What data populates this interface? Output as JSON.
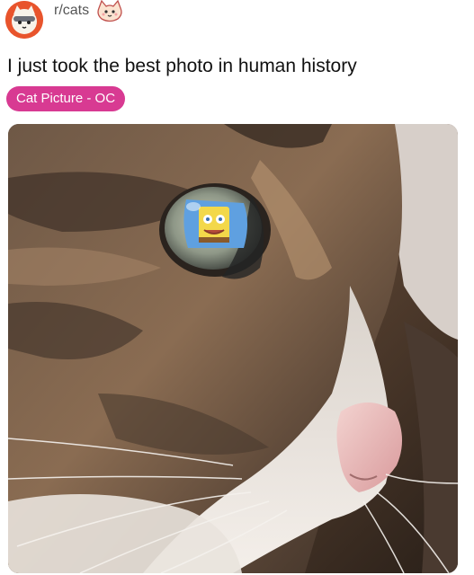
{
  "post": {
    "subreddit": "r/cats",
    "title": "I just took the best photo in human history",
    "flair": "Cat Picture - OC"
  },
  "colors": {
    "avatar_orange": "#e8542c",
    "flair_pink": "#d83a92",
    "subreddit_gray": "#555555"
  },
  "icons": {
    "subreddit_avatar": "cat-face-avatar-icon",
    "sticker": "cat-doodle-sticker-icon"
  }
}
